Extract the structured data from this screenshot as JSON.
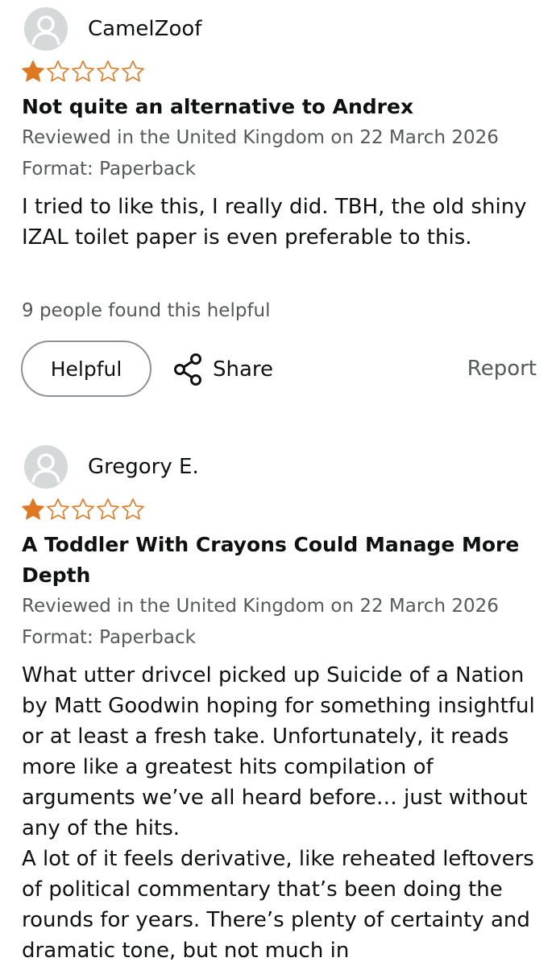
{
  "reviews": [
    {
      "reviewer": "CamelZoof",
      "rating": 1,
      "rating_max": 5,
      "title": "Not quite an alternative to Andrex",
      "reviewed_line": "Reviewed in the United Kingdom on 22 March 2026",
      "format": "Format: Paperback",
      "body": "I tried to like this, I really did. TBH, the old shiny IZAL toilet paper is even preferable to this.",
      "helpful_count": "9 people found this helpful",
      "helpful_label": "Helpful",
      "share_label": "Share",
      "report_label": "Report"
    },
    {
      "reviewer": "Gregory E.",
      "rating": 1,
      "rating_max": 5,
      "title": "A Toddler With Crayons Could Manage More Depth",
      "reviewed_line": "Reviewed in the United Kingdom on 22 March 2026",
      "format": "Format: Paperback",
      "body": "What utter drivcel picked up Suicide of a Nation by Matt Goodwin hoping for something insightful or at least a fresh take. Unfortunately, it reads more like a greatest hits compilation of arguments we’ve all heard before… just without any of the hits.\nA lot of it feels derivative, like reheated leftovers of political commentary that’s been doing the rounds for years. There’s plenty of certainty and dramatic tone, but not much in"
    }
  ],
  "colors": {
    "star_fill": "#de7921",
    "star_outline": "#de7921",
    "secondary_text": "#565959",
    "avatar_bg": "#d5d9d9"
  }
}
